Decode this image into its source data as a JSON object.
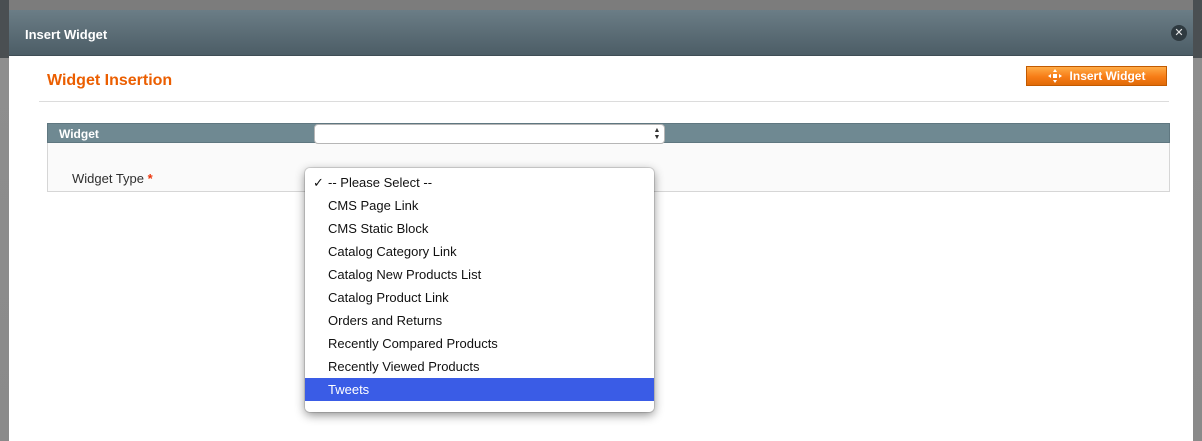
{
  "window": {
    "title": "Insert Widget",
    "close_glyph": "✕"
  },
  "page": {
    "title": "Widget Insertion"
  },
  "toolbar": {
    "insert_label": "Insert Widget",
    "insert_icon": "insert-widget-icon"
  },
  "fieldset": {
    "legend": "Widget"
  },
  "form": {
    "widget_type_label": "Widget Type",
    "required_mark": "*",
    "current_value": "-- Please Select --"
  },
  "dropdown": {
    "checkmark": "✓",
    "options": [
      "-- Please Select --",
      "CMS Page Link",
      "CMS Static Block",
      "Catalog Category Link",
      "Catalog New Products List",
      "Catalog Product Link",
      "Orders and Returns",
      "Recently Compared Products",
      "Recently Viewed Products",
      "Tweets"
    ],
    "checked_index": 0,
    "highlighted_index": 9
  },
  "colors": {
    "accent_orange": "#eb5e00",
    "button_orange": "#f77c16",
    "header_slate": "#6f8992",
    "highlight_blue": "#3a5ce6"
  }
}
